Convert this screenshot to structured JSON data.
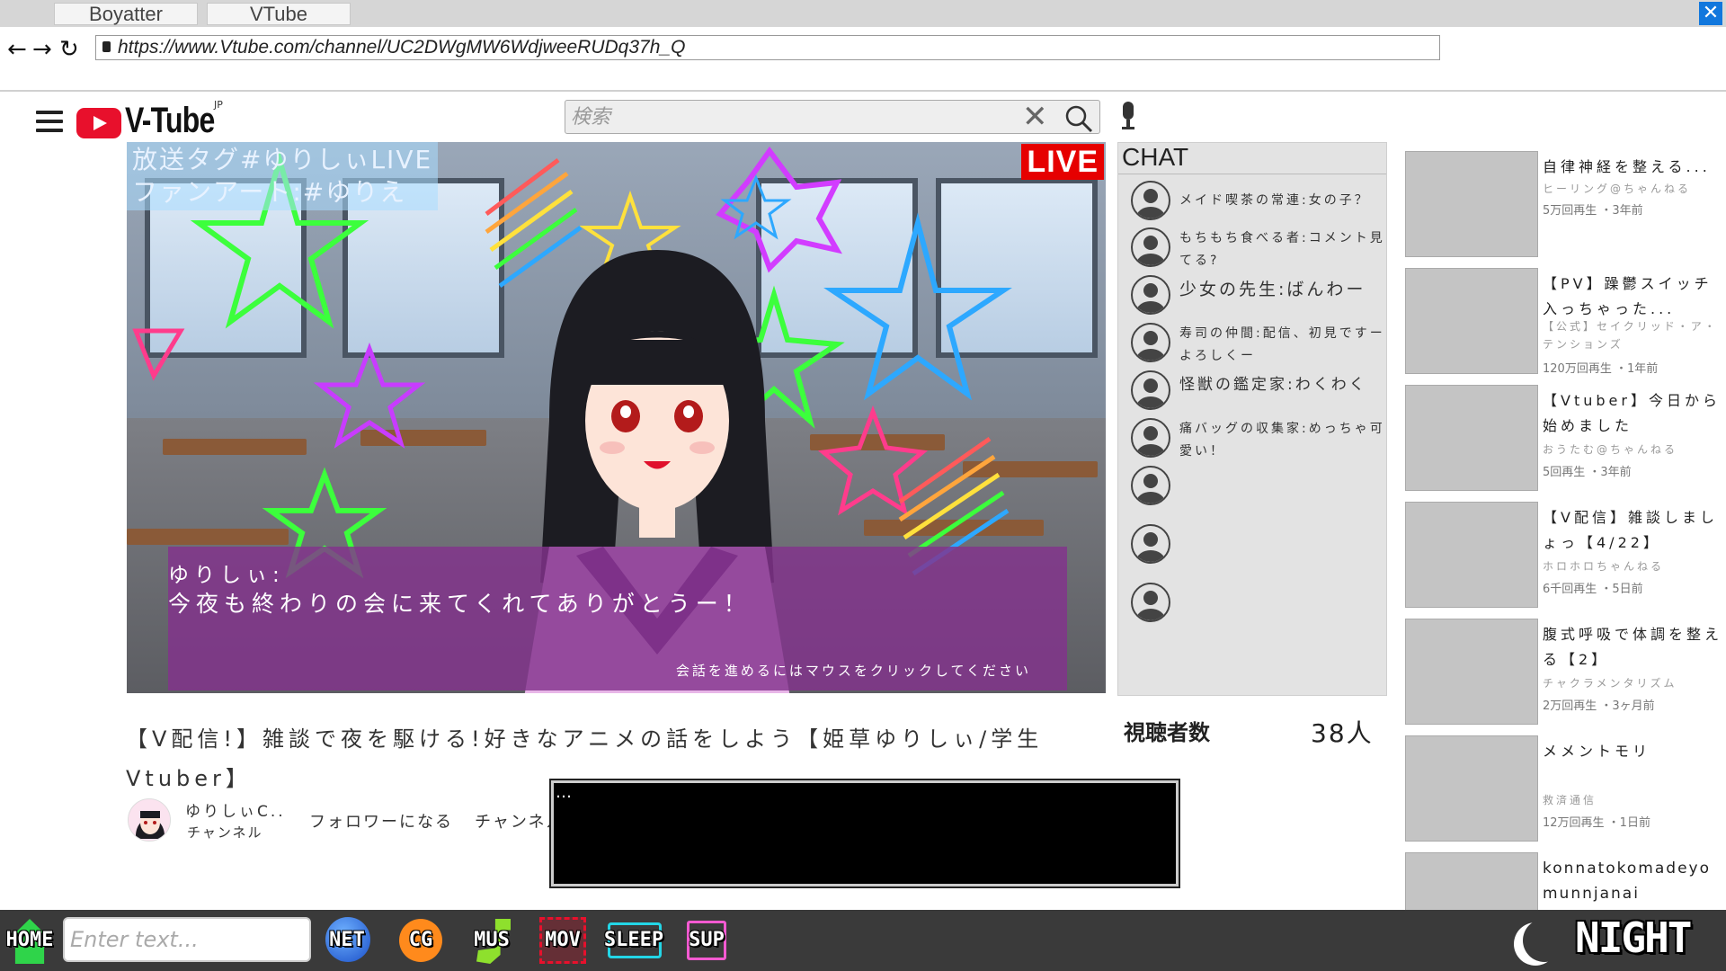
{
  "browser": {
    "tabs": [
      {
        "label": "Boyatter"
      },
      {
        "label": "VTube"
      }
    ],
    "url": "https://www.Vtube.com/channel/UC2DWgMW6WdjweeRUDq37h_Q"
  },
  "site": {
    "logo_text": "V-Tube",
    "logo_sup": "JP",
    "search_placeholder": "検索"
  },
  "video": {
    "tag_line1": "放送タグ#ゆりしぃLIVE",
    "tag_line2": "ファンアート:#ゆりえ",
    "live_label": "LIVE",
    "dialogue_speaker": "ゆりしぃ:",
    "dialogue_text": "今夜も終わりの会に来てくれてありがとうー！",
    "dialogue_hint": "会話を進めるにはマウスをクリックしてください"
  },
  "chat": {
    "title": "CHAT",
    "messages": [
      {
        "text": "メイド喫茶の常連:女の子？"
      },
      {
        "text": "もちもち食べる者:コメント見てる?"
      },
      {
        "text": "少女の先生:ばんわー"
      },
      {
        "text": "寿司の仲間:配信、初見ですーよろしくー"
      },
      {
        "text": "怪獣の鑑定家:わくわく"
      },
      {
        "text": "痛バッグの収集家:めっちゃ可愛い！"
      },
      {
        "text": ""
      },
      {
        "text": ""
      },
      {
        "text": ""
      }
    ],
    "viewers_label": "視聴者数",
    "viewers_count": "38人"
  },
  "info": {
    "title": "【V配信!】雑談で夜を駆ける!好きなアニメの話をしよう【姫草ゆりしぃ/学生Vtuber】",
    "channel_name": "ゆりしぃC..",
    "channel_sub": "チャンネル",
    "follow_label": "フォロワーになる",
    "channel_btn_label": "チャンネル",
    "message_box_text": "…"
  },
  "recommendations": [
    {
      "title": "自律神経を整える...",
      "channel": "ヒーリング@ちゃんねる",
      "meta": "5万回再生 ・3年前"
    },
    {
      "title": "【PV】躁鬱スイッチ入っちゃった...",
      "channel": "【公式】セイクリッド・ア・テンションズ",
      "meta": "120万回再生 ・1年前"
    },
    {
      "title": "【Vtuber】今日から始めました",
      "channel": "おうたむ@ちゃんねる",
      "meta": "5回再生 ・3年前"
    },
    {
      "title": "【V配信】雑談しましょっ【4/22】",
      "channel": "ホロホロちゃんねる",
      "meta": "6千回再生 ・5日前"
    },
    {
      "title": "腹式呼吸で体調を整える【2】",
      "channel": "チャクラメンタリズム",
      "meta": "2万回再生 ・3ヶ月前"
    },
    {
      "title": "メメントモリ",
      "channel": "救済通信",
      "meta": "12万回再生 ・1日前"
    },
    {
      "title": "konnatokomadeyo munnjanai",
      "channel": "",
      "meta": ""
    }
  ],
  "taskbar": {
    "home": "HOME",
    "input_placeholder": "Enter text...",
    "net": "NET",
    "cg": "CG",
    "mus": "MUS",
    "mov": "MOV",
    "sleep": "SLEEP",
    "sup": "SUP",
    "night": "NIGHT"
  },
  "colors": {
    "live_red": "#e60000",
    "logo_red": "#e8102c",
    "dialogue_bg": "#82328c",
    "taskbar_bg": "#3a3a3a"
  }
}
